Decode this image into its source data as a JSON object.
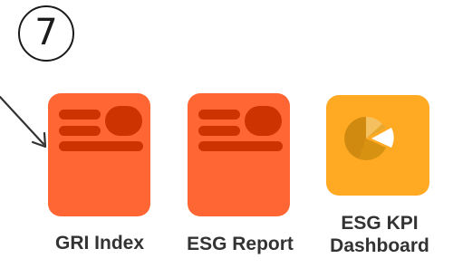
{
  "step": {
    "number": "7"
  },
  "tiles": [
    {
      "id": "gri",
      "label": "GRI Index",
      "icon": "document-layout-icon",
      "color": "#ff6633"
    },
    {
      "id": "esg",
      "label": "ESG Report",
      "icon": "document-layout-icon",
      "color": "#ff6633"
    },
    {
      "id": "kpi",
      "label_line1": "ESG KPI",
      "label_line2": "Dashboard",
      "icon": "pie-chart-icon",
      "color": "#ffaa22"
    }
  ],
  "colors": {
    "orange_tile": "#ff6633",
    "orange_tile_detail": "#cc3300",
    "yellow_tile": "#ffaa22",
    "pie_dark": "#d08a10",
    "pie_light": "#f5c060",
    "label_text": "#333333"
  }
}
